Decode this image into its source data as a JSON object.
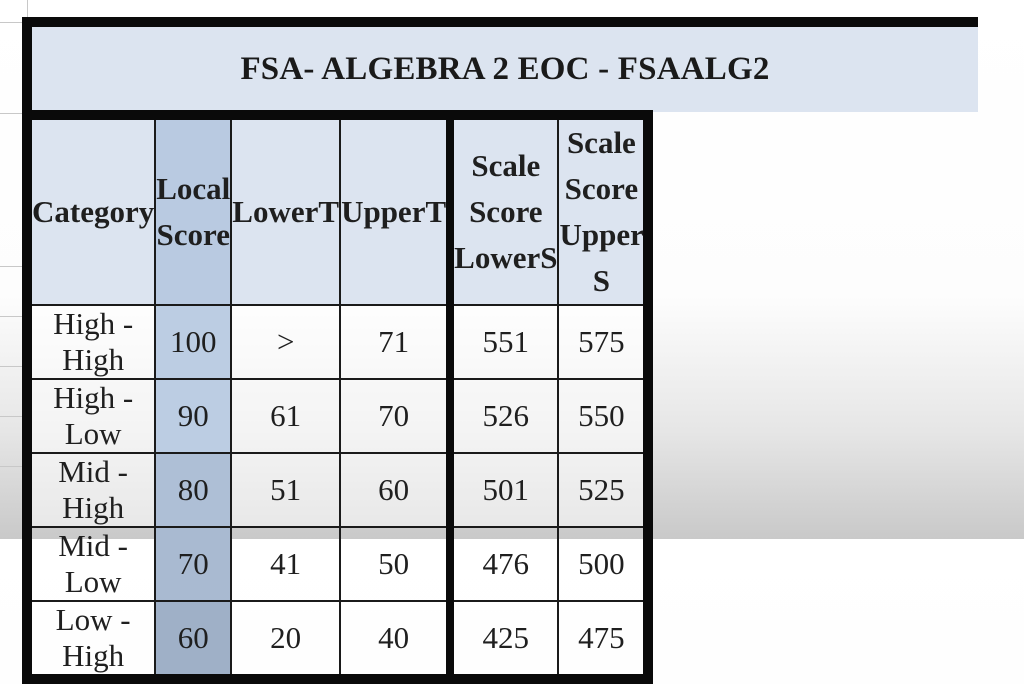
{
  "title": "FSA- ALGEBRA 2 EOC - FSAALG2",
  "columns": [
    {
      "key": "category",
      "label": "Category"
    },
    {
      "key": "local_score",
      "label": "Local Score"
    },
    {
      "key": "lower_t",
      "label": "LowerT"
    },
    {
      "key": "upper_t",
      "label": "UpperT"
    },
    {
      "key": "scale_lower",
      "label": "Scale Score LowerS"
    },
    {
      "key": "scale_upper",
      "label": "Scale Score Upper S"
    }
  ],
  "header_lines": {
    "local_score": [
      "Local",
      "Score"
    ],
    "scale_lower": [
      "Scale",
      "Score",
      "LowerS"
    ],
    "scale_upper": [
      "Scale",
      "Score",
      "Upper S"
    ]
  },
  "rows": [
    {
      "category": "High - High",
      "local_score": "100",
      "lower_t": ">",
      "upper_t": "71",
      "scale_lower": "551",
      "scale_upper": "575"
    },
    {
      "category": "High - Low",
      "local_score": "90",
      "lower_t": "61",
      "upper_t": "70",
      "scale_lower": "526",
      "scale_upper": "550"
    },
    {
      "category": "Mid - High",
      "local_score": "80",
      "lower_t": "51",
      "upper_t": "60",
      "scale_lower": "501",
      "scale_upper": "525"
    },
    {
      "category": "Mid - Low",
      "local_score": "70",
      "lower_t": "41",
      "upper_t": "50",
      "scale_lower": "476",
      "scale_upper": "500"
    },
    {
      "category": "Low - High",
      "local_score": "60",
      "lower_t": "20",
      "upper_t": "40",
      "scale_lower": "425",
      "scale_upper": "475"
    }
  ],
  "colors": {
    "header_fill": "#dce4f0",
    "local_score_fill": "#b9cae1",
    "border": "#0a0a0a"
  }
}
